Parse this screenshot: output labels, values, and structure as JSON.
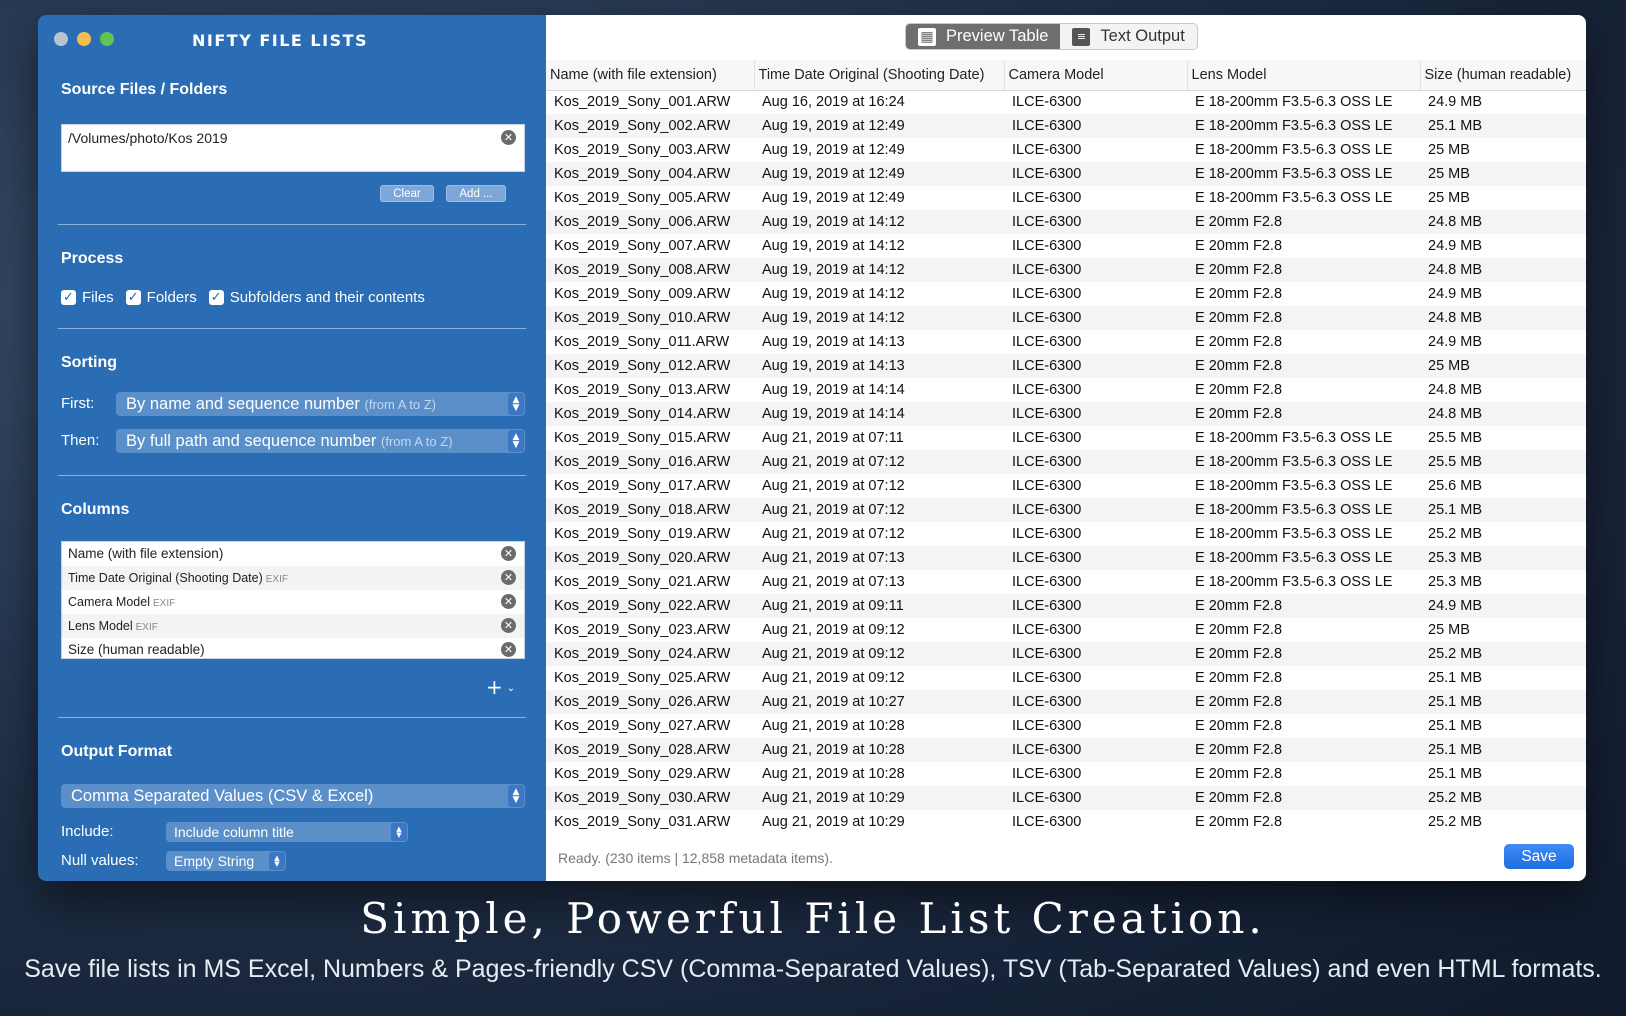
{
  "app": {
    "title": "NIFTY FILE LISTS"
  },
  "sidebar": {
    "source": {
      "heading": "Source Files / Folders",
      "path": "/Volumes/photo/Kos 2019",
      "clear_label": "Clear",
      "add_label": "Add ..."
    },
    "process": {
      "heading": "Process",
      "options": [
        "Files",
        "Folders",
        "Subfolders and their contents"
      ]
    },
    "sorting": {
      "heading": "Sorting",
      "first_label": "First:",
      "first_value": "By name and sequence number",
      "first_hint": "(from A to Z)",
      "then_label": "Then:",
      "then_value": "By full path and sequence number",
      "then_hint": "(from A to Z)"
    },
    "columns": {
      "heading": "Columns",
      "items": [
        {
          "label": "Name (with file extension)",
          "tag": ""
        },
        {
          "label": "Time Date Original (Shooting Date)",
          "tag": "EXIF"
        },
        {
          "label": "Camera Model",
          "tag": "EXIF"
        },
        {
          "label": "Lens Model",
          "tag": "EXIF"
        },
        {
          "label": "Size (human readable)",
          "tag": ""
        }
      ]
    },
    "output": {
      "heading": "Output Format",
      "format": "Comma Separated Values (CSV & Excel)",
      "include_label": "Include:",
      "include_value": "Include column title",
      "null_label": "Null values:",
      "null_value": "Empty String"
    }
  },
  "main": {
    "tabs": {
      "preview": "Preview Table",
      "text": "Text Output"
    },
    "table": {
      "headers": [
        "Name (with file extension)",
        "Time Date Original (Shooting Date)",
        "Camera Model",
        "Lens Model",
        "Size (human readable)"
      ],
      "rows": [
        [
          "Kos_2019_Sony_001.ARW",
          "Aug 16, 2019 at 16:24",
          "ILCE-6300",
          "E 18-200mm F3.5-6.3 OSS LE",
          "24.9 MB"
        ],
        [
          "Kos_2019_Sony_002.ARW",
          "Aug 19, 2019 at 12:49",
          "ILCE-6300",
          "E 18-200mm F3.5-6.3 OSS LE",
          "25.1 MB"
        ],
        [
          "Kos_2019_Sony_003.ARW",
          "Aug 19, 2019 at 12:49",
          "ILCE-6300",
          "E 18-200mm F3.5-6.3 OSS LE",
          "25 MB"
        ],
        [
          "Kos_2019_Sony_004.ARW",
          "Aug 19, 2019 at 12:49",
          "ILCE-6300",
          "E 18-200mm F3.5-6.3 OSS LE",
          "25 MB"
        ],
        [
          "Kos_2019_Sony_005.ARW",
          "Aug 19, 2019 at 12:49",
          "ILCE-6300",
          "E 18-200mm F3.5-6.3 OSS LE",
          "25 MB"
        ],
        [
          "Kos_2019_Sony_006.ARW",
          "Aug 19, 2019 at 14:12",
          "ILCE-6300",
          "E 20mm F2.8",
          "24.8 MB"
        ],
        [
          "Kos_2019_Sony_007.ARW",
          "Aug 19, 2019 at 14:12",
          "ILCE-6300",
          "E 20mm F2.8",
          "24.9 MB"
        ],
        [
          "Kos_2019_Sony_008.ARW",
          "Aug 19, 2019 at 14:12",
          "ILCE-6300",
          "E 20mm F2.8",
          "24.8 MB"
        ],
        [
          "Kos_2019_Sony_009.ARW",
          "Aug 19, 2019 at 14:12",
          "ILCE-6300",
          "E 20mm F2.8",
          "24.9 MB"
        ],
        [
          "Kos_2019_Sony_010.ARW",
          "Aug 19, 2019 at 14:12",
          "ILCE-6300",
          "E 20mm F2.8",
          "24.8 MB"
        ],
        [
          "Kos_2019_Sony_011.ARW",
          "Aug 19, 2019 at 14:13",
          "ILCE-6300",
          "E 20mm F2.8",
          "24.9 MB"
        ],
        [
          "Kos_2019_Sony_012.ARW",
          "Aug 19, 2019 at 14:13",
          "ILCE-6300",
          "E 20mm F2.8",
          "25 MB"
        ],
        [
          "Kos_2019_Sony_013.ARW",
          "Aug 19, 2019 at 14:14",
          "ILCE-6300",
          "E 20mm F2.8",
          "24.8 MB"
        ],
        [
          "Kos_2019_Sony_014.ARW",
          "Aug 19, 2019 at 14:14",
          "ILCE-6300",
          "E 20mm F2.8",
          "24.8 MB"
        ],
        [
          "Kos_2019_Sony_015.ARW",
          "Aug 21, 2019 at 07:11",
          "ILCE-6300",
          "E 18-200mm F3.5-6.3 OSS LE",
          "25.5 MB"
        ],
        [
          "Kos_2019_Sony_016.ARW",
          "Aug 21, 2019 at 07:12",
          "ILCE-6300",
          "E 18-200mm F3.5-6.3 OSS LE",
          "25.5 MB"
        ],
        [
          "Kos_2019_Sony_017.ARW",
          "Aug 21, 2019 at 07:12",
          "ILCE-6300",
          "E 18-200mm F3.5-6.3 OSS LE",
          "25.6 MB"
        ],
        [
          "Kos_2019_Sony_018.ARW",
          "Aug 21, 2019 at 07:12",
          "ILCE-6300",
          "E 18-200mm F3.5-6.3 OSS LE",
          "25.1 MB"
        ],
        [
          "Kos_2019_Sony_019.ARW",
          "Aug 21, 2019 at 07:12",
          "ILCE-6300",
          "E 18-200mm F3.5-6.3 OSS LE",
          "25.2 MB"
        ],
        [
          "Kos_2019_Sony_020.ARW",
          "Aug 21, 2019 at 07:13",
          "ILCE-6300",
          "E 18-200mm F3.5-6.3 OSS LE",
          "25.3 MB"
        ],
        [
          "Kos_2019_Sony_021.ARW",
          "Aug 21, 2019 at 07:13",
          "ILCE-6300",
          "E 18-200mm F3.5-6.3 OSS LE",
          "25.3 MB"
        ],
        [
          "Kos_2019_Sony_022.ARW",
          "Aug 21, 2019 at 09:11",
          "ILCE-6300",
          "E 20mm F2.8",
          "24.9 MB"
        ],
        [
          "Kos_2019_Sony_023.ARW",
          "Aug 21, 2019 at 09:12",
          "ILCE-6300",
          "E 20mm F2.8",
          "25 MB"
        ],
        [
          "Kos_2019_Sony_024.ARW",
          "Aug 21, 2019 at 09:12",
          "ILCE-6300",
          "E 20mm F2.8",
          "25.2 MB"
        ],
        [
          "Kos_2019_Sony_025.ARW",
          "Aug 21, 2019 at 09:12",
          "ILCE-6300",
          "E 20mm F2.8",
          "25.1 MB"
        ],
        [
          "Kos_2019_Sony_026.ARW",
          "Aug 21, 2019 at 10:27",
          "ILCE-6300",
          "E 20mm F2.8",
          "25.1 MB"
        ],
        [
          "Kos_2019_Sony_027.ARW",
          "Aug 21, 2019 at 10:28",
          "ILCE-6300",
          "E 20mm F2.8",
          "25.1 MB"
        ],
        [
          "Kos_2019_Sony_028.ARW",
          "Aug 21, 2019 at 10:28",
          "ILCE-6300",
          "E 20mm F2.8",
          "25.1 MB"
        ],
        [
          "Kos_2019_Sony_029.ARW",
          "Aug 21, 2019 at 10:28",
          "ILCE-6300",
          "E 20mm F2.8",
          "25.1 MB"
        ],
        [
          "Kos_2019_Sony_030.ARW",
          "Aug 21, 2019 at 10:29",
          "ILCE-6300",
          "E 20mm F2.8",
          "25.2 MB"
        ],
        [
          "Kos_2019_Sony_031.ARW",
          "Aug 21, 2019 at 10:29",
          "ILCE-6300",
          "E 20mm F2.8",
          "25.2 MB"
        ]
      ]
    },
    "status": "Ready. (230 items | 12,858 metadata items).",
    "save_label": "Save"
  },
  "promo": {
    "headline": "Simple, Powerful File List Creation.",
    "subline": "Save file lists in MS Excel, Numbers & Pages-friendly CSV (Comma-Separated Values),  TSV (Tab-Separated Values) and even HTML formats."
  },
  "colors": {
    "sidebar": "#2a6db4",
    "accent": "#1f6ee0"
  }
}
